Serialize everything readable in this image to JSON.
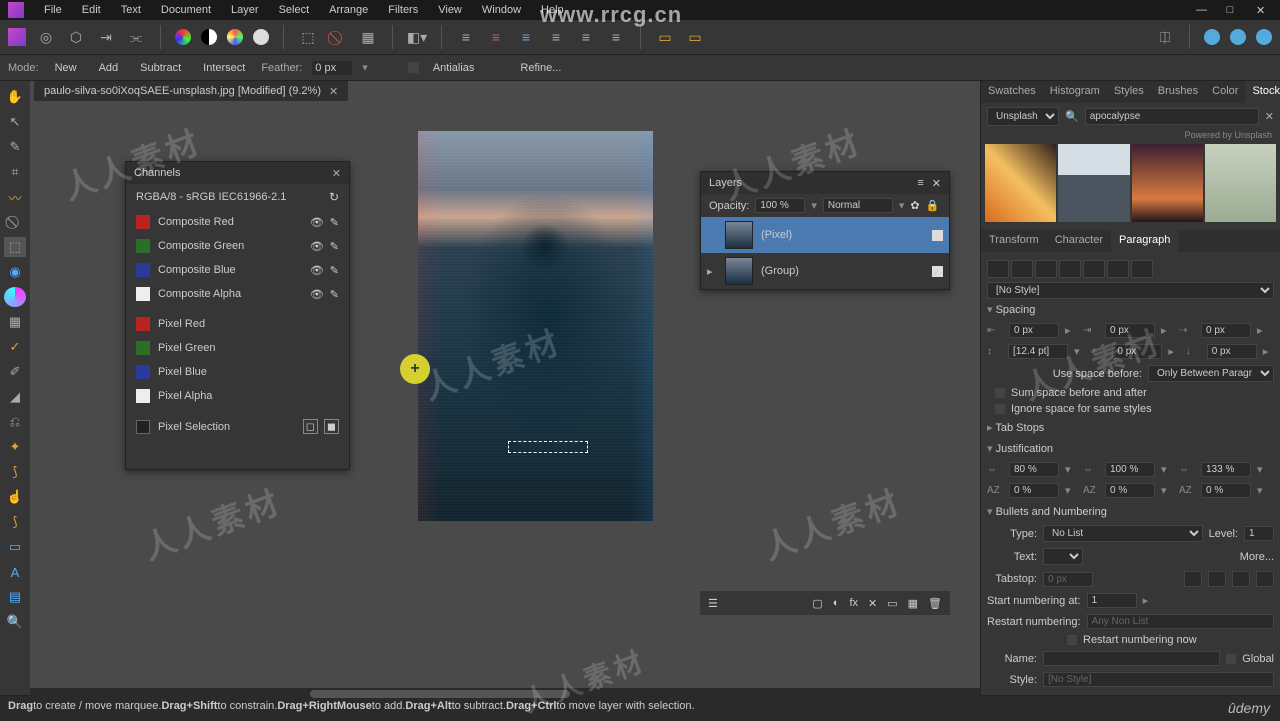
{
  "menu": {
    "items": [
      "File",
      "Edit",
      "Text",
      "Document",
      "Layer",
      "Select",
      "Arrange",
      "Filters",
      "View",
      "Window",
      "Help"
    ]
  },
  "context": {
    "mode_label": "Mode:",
    "modes": [
      "New",
      "Add",
      "Subtract",
      "Intersect"
    ],
    "feather_label": "Feather:",
    "feather_value": "0 px",
    "antialias": "Antialias",
    "refine": "Refine..."
  },
  "tab": {
    "title": "paulo-silva-so0iXoqSAEE-unsplash.jpg [Modified] (9.2%)"
  },
  "channels": {
    "title": "Channels",
    "profile": "RGBA/8 - sRGB IEC61966-2.1",
    "rows": [
      {
        "color": "#b22",
        "name": "Composite Red"
      },
      {
        "color": "#2a6e2a",
        "name": "Composite Green"
      },
      {
        "color": "#2a3a9a",
        "name": "Composite Blue"
      },
      {
        "color": "#eee",
        "name": "Composite Alpha"
      },
      {
        "color": "#b22",
        "name": "Pixel Red"
      },
      {
        "color": "#2a6e2a",
        "name": "Pixel Green"
      },
      {
        "color": "#2a3a9a",
        "name": "Pixel Blue"
      },
      {
        "color": "#eee",
        "name": "Pixel Alpha"
      },
      {
        "color": "#222",
        "name": "Pixel Selection"
      }
    ]
  },
  "layers": {
    "title": "Layers",
    "opacity_label": "Opacity:",
    "opacity": "100 %",
    "blend": "Normal",
    "items": [
      {
        "name": "(Pixel)",
        "sel": true
      },
      {
        "name": "(Group)",
        "sel": false
      }
    ]
  },
  "right_tabs": [
    "Swatches",
    "Histogram",
    "Styles",
    "Brushes",
    "Color",
    "Stock"
  ],
  "stock": {
    "source": "Unsplash",
    "query": "apocalypse",
    "powered": "Powered by Unsplash"
  },
  "right_tabs2": [
    "Transform",
    "Character",
    "Paragraph"
  ],
  "paragraph": {
    "no_style": "[No Style]",
    "spacing": "Spacing",
    "left": "0 px",
    "right": "0 px",
    "first": "0 px",
    "leading": "[12.4 pt]",
    "before": "0 px",
    "after": "0 px",
    "use_before_label": "Use space before:",
    "use_before": "Only Between Paragr",
    "sum": "Sum space before and after",
    "ignore": "Ignore space for same styles",
    "tabstops": "Tab Stops",
    "justification": "Justification",
    "j1": "80 %",
    "j2": "100 %",
    "j3": "133 %",
    "j4": "0 %",
    "j5": "0 %",
    "j6": "0 %",
    "bullets": "Bullets and Numbering",
    "type_label": "Type:",
    "type": "No List",
    "level_label": "Level:",
    "level": "1",
    "text_label": "Text:",
    "more": "More...",
    "tabstop_label": "Tabstop:",
    "tabstop": "0 px",
    "start_label": "Start numbering at:",
    "start": "1",
    "restart_label": "Restart numbering:",
    "restart": "Any Non List",
    "restart_now": "Restart numbering now",
    "name_label": "Name:",
    "global": "Global",
    "style_label": "Style:",
    "style": "[No Style]"
  },
  "status": {
    "t1": "Drag",
    "s1": " to create / move marquee. ",
    "t2": "Drag+Shift",
    "s2": " to constrain. ",
    "t3": "Drag+RightMouse",
    "s3": " to add. ",
    "t4": "Drag+Alt",
    "s4": " to subtract. ",
    "t5": "Drag+Ctrl",
    "s5": " to move layer with selection."
  },
  "watermark": {
    "text": "人人素材",
    "url": "www.rrcg.cn",
    "udemy": "ûdemy"
  }
}
